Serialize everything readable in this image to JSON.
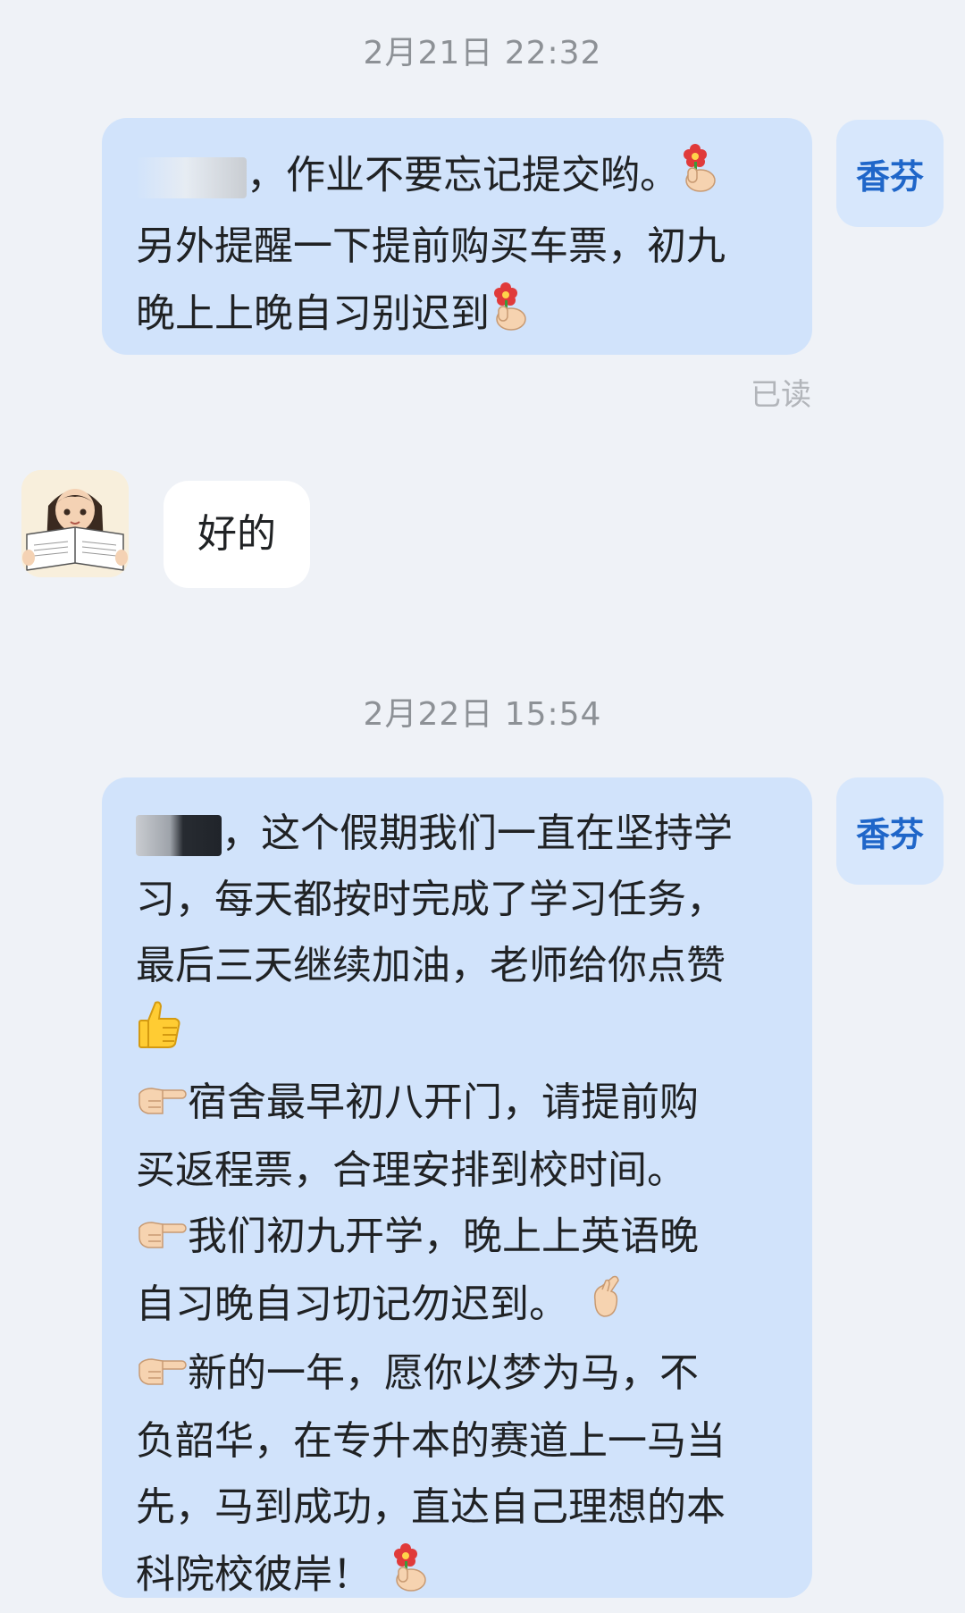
{
  "messages": [
    {
      "timestamp": "2月21日 22:32",
      "sender_tag": "香芬",
      "lines": [
        "，作业不要忘记提交哟。",
        "另外提醒一下提前购买车票，初九",
        "晚上上晚自习别迟到"
      ],
      "emojis": [
        "flower-hand-icon",
        "flower-hand-icon"
      ],
      "read_status": "已读"
    },
    {
      "reply": "好的"
    },
    {
      "timestamp": "2月22日 15:54",
      "sender_tag": "香芬",
      "lines": [
        "，这个假期我们一直在坚持学",
        "习，每天都按时完成了学习任务，",
        "最后三天继续加油，老师给你点赞",
        "宿舍最早初八开门，请提前购",
        "买返程票，合理安排到校时间。",
        "我们初九开学，晚上上英语晚",
        "自习晚自习切记勿迟到。",
        "新的一年，愿你以梦为马，不",
        "负韶华，在专升本的赛道上一马当",
        "先，马到成功，直达自己理想的本",
        "科院校彼岸！"
      ],
      "emojis": [
        "thumbs-up-icon",
        "pointing-hand-icon",
        "pointing-hand-icon",
        "finger-heart-icon",
        "pointing-hand-icon",
        "flower-hand-icon"
      ]
    }
  ],
  "colors": {
    "background": "#eff2f7",
    "outgoing_bubble": "#d1e3fb",
    "incoming_bubble": "#ffffff",
    "sender_tag_text": "#1f66c9"
  }
}
